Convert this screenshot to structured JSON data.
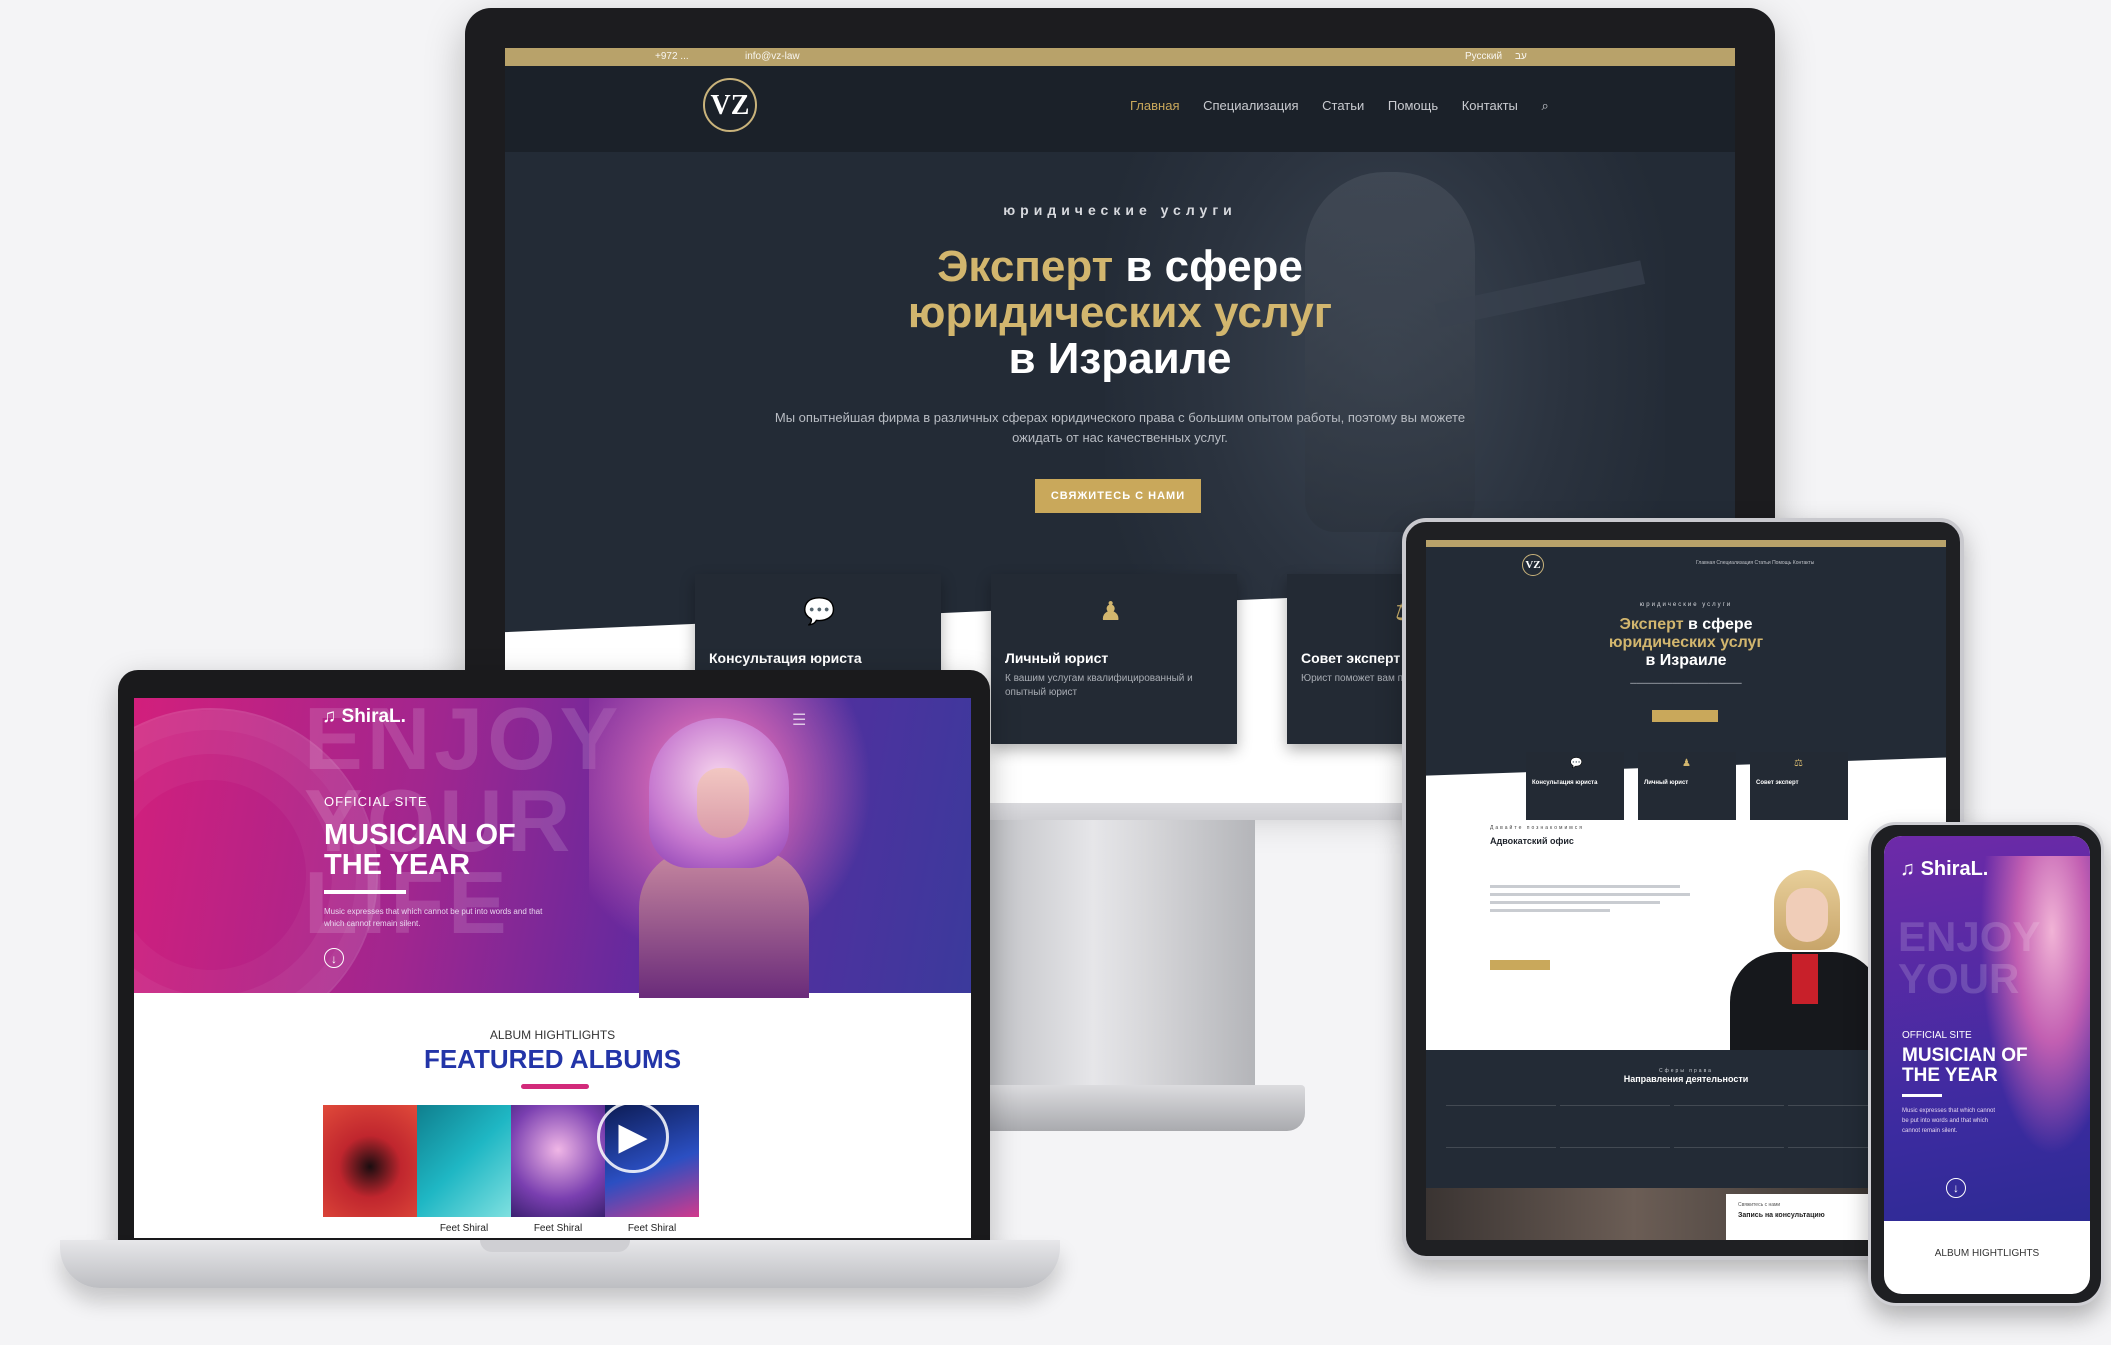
{
  "desktop": {
    "topbar_phone": "+972 ...",
    "topbar_email": "info@vz-law",
    "topbar_lang_1": "Русский",
    "topbar_lang_2": "עב",
    "logo": "VZ",
    "nav": [
      "Главная",
      "Специализация",
      "Статьи",
      "Помощь",
      "Контакты"
    ],
    "hero_kicker": "юридические услуги",
    "hero_title_gold_1": "Эксперт",
    "hero_title_white_1": " в сфере",
    "hero_title_gold_2": "юридических услуг",
    "hero_title_white_2": "в Израиле",
    "hero_text": "Мы опытнейшая фирма в различных сферах юридического права с большим опытом работы, поэтому вы можете ожидать от нас качественных услуг.",
    "hero_button": "СВЯЖИТЕСЬ С НАМИ",
    "cards": [
      {
        "title": "Консультация юриста",
        "desc": "",
        "icon": "chat-icon"
      },
      {
        "title": "Личный юрист",
        "desc": "К вашим услугам квалифицированный и опытный юрист",
        "icon": "person-icon"
      },
      {
        "title": "Совет эксперт",
        "desc": "Юрист поможет вам правильно решить",
        "icon": "advice-icon"
      }
    ]
  },
  "laptop": {
    "brand": "ShiraL.",
    "enjoy_bg": "ENJOY YOUR LIFE",
    "kicker": "OFFICIAL SITE",
    "headline_1": "MUSICIAN OF",
    "headline_2": "THE YEAR",
    "blurb": "Music expresses that which cannot be put into words and that which cannot remain silent.",
    "album_kicker": "ALBUM HIGHTLIGHTS",
    "album_title": "FEATURED ALBUMS",
    "albums": [
      {
        "caption": "",
        "color": "#c0262e"
      },
      {
        "caption": "Feet Shiral",
        "color": "#1fb7c4"
      },
      {
        "caption": "Feet Shiral",
        "color": "#7a3fb0"
      },
      {
        "caption": "Feet Shiral",
        "color": "#2b4fc2"
      }
    ]
  },
  "tablet": {
    "logo": "VZ",
    "nav": "Главная  Специализация  Статьи  Помощь  Контакты",
    "kicker": "юридические услуги",
    "title_gold_1": "Эксперт",
    "title_white_1": " в сфере",
    "title_gold_2": "юридических услуг",
    "title_white_2": "в Израиле",
    "cards": [
      "Консультация юриста",
      "Личный юрист",
      "Совет эксперт"
    ],
    "about_kicker": "Давайте познакомимся",
    "about_title": "Адвокатский офис",
    "areas_kicker": "Сферы права",
    "areas_title": "Направления деятельности",
    "box_kicker": "Свяжитесь с нами",
    "box_title": "Запись на консультацию"
  },
  "phone": {
    "brand": "ShiraL.",
    "enjoy_bg": "ENJOY YOUR",
    "kicker": "OFFICIAL SITE",
    "headline_1": "MUSICIAN OF",
    "headline_2": "THE YEAR",
    "blurb": "Music expresses that which cannot be put into words and that which cannot remain silent.",
    "album_kicker": "ALBUM HIGHTLIGHTS"
  },
  "colors": {
    "gold": "#c9a85b",
    "navy": "#232b36",
    "magenta": "#d21f7c",
    "purple": "#5d2aa0",
    "album_blue": "#2335a8"
  }
}
